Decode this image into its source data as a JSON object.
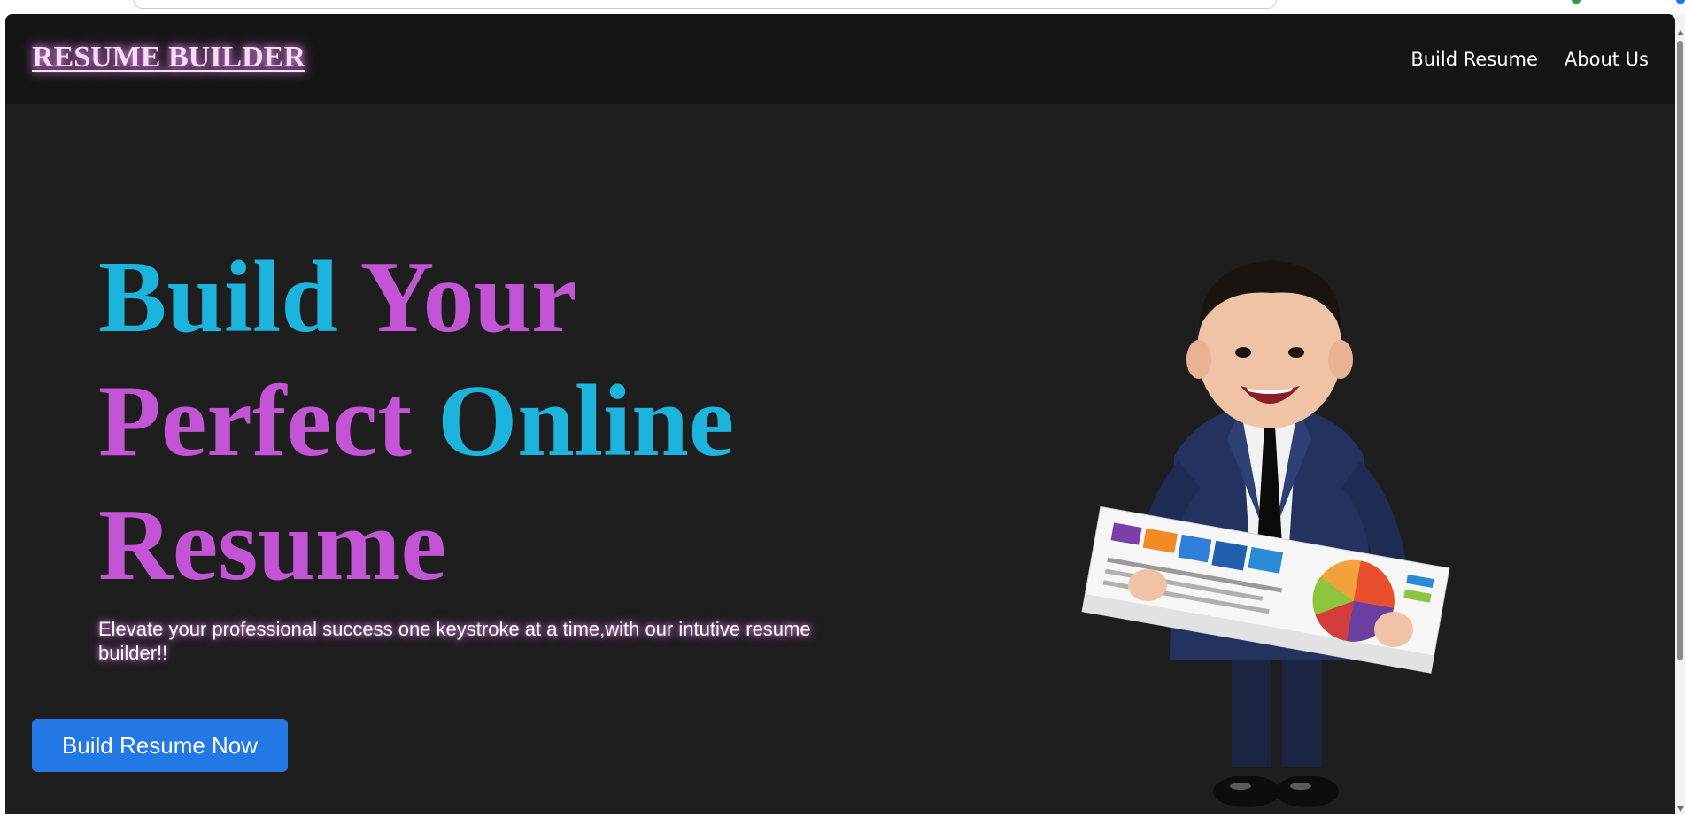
{
  "navbar": {
    "brand": "RESUME BUILDER",
    "links": [
      "Build Resume",
      "About Us"
    ]
  },
  "hero": {
    "title_words": [
      "Build",
      "Your",
      "Perfect",
      "Online",
      "Resume"
    ],
    "subtitle": "Elevate your professional success one keystroke at a time,with our intutive resume builder!!",
    "cta_label": "Build Resume Now"
  },
  "illustration": {
    "icon": "baby-businessman-holding-report-illustration"
  },
  "colors": {
    "page_background": "#1e1e1e",
    "navbar_background": "#151515",
    "title_blue": "#1cb3dc",
    "title_purple": "#c354d6",
    "brand_glow": "#d283d8",
    "button_blue": "#2378e6",
    "text_white": "#ffffff"
  }
}
